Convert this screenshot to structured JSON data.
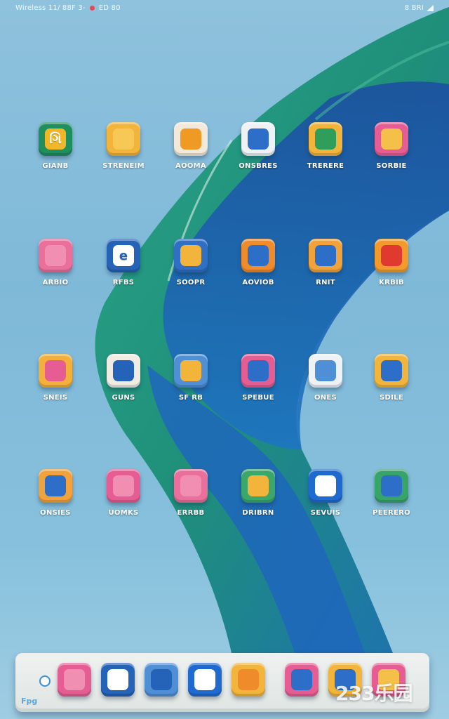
{
  "status_bar": {
    "left_text": "Wireless 11/ 88F 3-",
    "left_badge": "ED 80",
    "right_text": "8 BRI"
  },
  "apps": [
    {
      "label": "GIANB",
      "glyph": "ગિ",
      "icon": "green-tile-icon",
      "base": "#1f8f5e",
      "inner": "#f2b629"
    },
    {
      "label": "STRENEIM",
      "glyph": "",
      "icon": "yellow-face-icon",
      "base": "#f2b43a",
      "inner": "#f8c856"
    },
    {
      "label": "AOOMA",
      "glyph": "",
      "icon": "orange-frame-icon",
      "base": "#f3e9d8",
      "inner": "#f09a26"
    },
    {
      "label": "ONSBRES",
      "glyph": "",
      "icon": "blue-white-icon",
      "base": "#eef2f5",
      "inner": "#2d6fc8"
    },
    {
      "label": "TRERERE",
      "glyph": "",
      "icon": "yellow-leaf-icon",
      "base": "#f2b43a",
      "inner": "#2e9e5a"
    },
    {
      "label": "SORBIE",
      "glyph": "",
      "icon": "pink-yellow-icon",
      "base": "#e55d92",
      "inner": "#f4c04a"
    },
    {
      "label": "ARBIO",
      "glyph": "",
      "icon": "pink-tile-icon",
      "base": "#ea6f9b",
      "inner": "#f08fb2"
    },
    {
      "label": "RFBS",
      "glyph": "e",
      "icon": "blue-e-icon",
      "base": "#2463b8",
      "inner": "#ffffff"
    },
    {
      "label": "SOOPR",
      "glyph": "",
      "icon": "blue-yellow-icon",
      "base": "#2f6fc6",
      "inner": "#f2b43a"
    },
    {
      "label": "AOVIOB",
      "glyph": "",
      "icon": "orange-blue-icon",
      "base": "#f08b2c",
      "inner": "#2d6fc8"
    },
    {
      "label": "RNIT",
      "glyph": "",
      "icon": "orange-flower-icon",
      "base": "#f2a23a",
      "inner": "#2d6fc8"
    },
    {
      "label": "KRBIB",
      "glyph": "",
      "icon": "red-person-icon",
      "base": "#f39a2c",
      "inner": "#e0392f"
    },
    {
      "label": "SNEIS",
      "glyph": "",
      "icon": "yellow-pink-icon",
      "base": "#f3b03a",
      "inner": "#e55d92"
    },
    {
      "label": "GUNS",
      "glyph": "",
      "icon": "blue-circle-icon",
      "base": "#f0ece4",
      "inner": "#2463b8"
    },
    {
      "label": "SF RB",
      "glyph": "",
      "icon": "blue-bird-icon",
      "base": "#4f8fd6",
      "inner": "#f2b43a"
    },
    {
      "label": "SPEBUE",
      "glyph": "",
      "icon": "pink-blue-icon",
      "base": "#e55d92",
      "inner": "#2d6fc8"
    },
    {
      "label": "ONES",
      "glyph": "",
      "icon": "white-blue-icon",
      "base": "#eef2f5",
      "inner": "#4f8fd6"
    },
    {
      "label": "SDILE",
      "glyph": "",
      "icon": "yellow-blue-icon",
      "base": "#f2b43a",
      "inner": "#2d6fc8"
    },
    {
      "label": "ONSIES",
      "glyph": "",
      "icon": "orange-blue-frame-icon",
      "base": "#f2a23a",
      "inner": "#2d6fc8"
    },
    {
      "label": "UOMKS",
      "glyph": "",
      "icon": "pink-hook-icon",
      "base": "#e55d92",
      "inner": "#f08fb2"
    },
    {
      "label": "ERRBB",
      "glyph": "",
      "icon": "pink-cloud-icon",
      "base": "#ea6f9b",
      "inner": "#f08fb2"
    },
    {
      "label": "DRIBRN",
      "glyph": "",
      "icon": "yellow-green-icon",
      "base": "#3aa86a",
      "inner": "#f2b43a"
    },
    {
      "label": "SEVUIS",
      "glyph": "",
      "icon": "blue-arrow-icon",
      "base": "#1f6ad0",
      "inner": "#ffffff"
    },
    {
      "label": "PEERERO",
      "glyph": "",
      "icon": "green-blue-icon",
      "base": "#37a46a",
      "inner": "#2d6fc8"
    }
  ],
  "dock": {
    "caption": "Fpg",
    "apps": [
      {
        "icon": "pink-dock-icon",
        "base": "#e55d92",
        "inner": "#f08fb2"
      },
      {
        "icon": "blue-check-icon",
        "base": "#2463b8",
        "inner": "#ffffff"
      },
      {
        "icon": "blue-wave-icon",
        "base": "#4f8fd6",
        "inner": "#2463b8"
      },
      {
        "icon": "blue-mail-icon",
        "base": "#1f6ad0",
        "inner": "#ffffff"
      },
      {
        "icon": "yellow-pen-icon",
        "base": "#f2b43a",
        "inner": "#f08b2c"
      },
      {
        "icon": "pink-triangle-icon",
        "base": "#e55d92",
        "inner": "#2d6fc8"
      },
      {
        "icon": "yellow-blue-dock-icon",
        "base": "#f2b43a",
        "inner": "#2d6fc8"
      },
      {
        "icon": "pink-heart-icon",
        "base": "#e55d92",
        "inner": "#f4c04a"
      }
    ]
  },
  "watermark": "233乐园"
}
